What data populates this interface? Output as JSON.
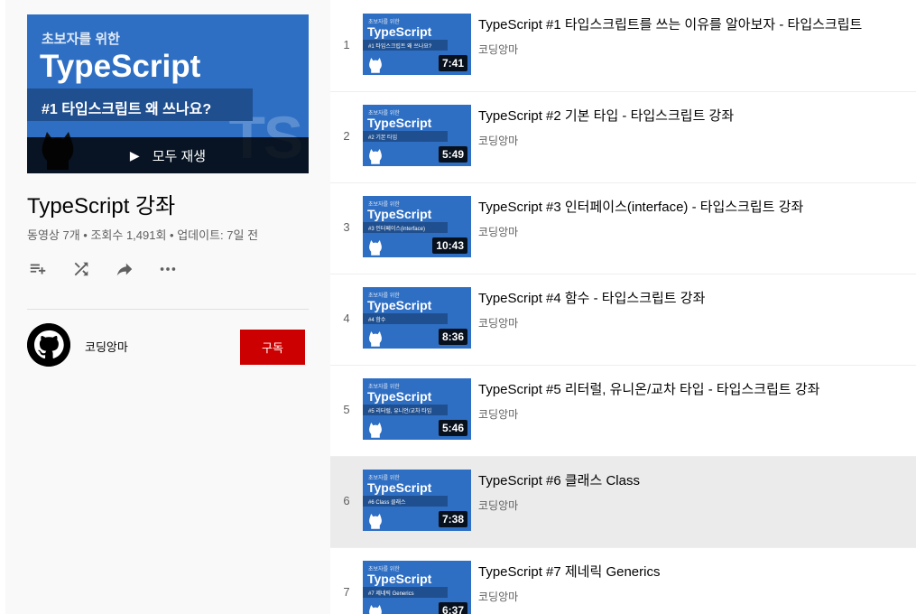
{
  "playlist": {
    "hero": {
      "kicker": "초보자를 위한",
      "title": "TypeScript",
      "subtitle": "#1 타입스크립트 왜 쓰나요?",
      "watermark": "TS",
      "play_all_label": "모두 재생",
      "play_icon": "play-icon"
    },
    "title": "TypeScript 강좌",
    "stats": "동영상 7개 • 조회수 1,491회 • 업데이트: 7일 전",
    "actions": [
      {
        "icon": "add-to-queue-icon"
      },
      {
        "icon": "shuffle-icon"
      },
      {
        "icon": "share-icon"
      },
      {
        "icon": "more-icon"
      }
    ],
    "owner": {
      "name": "코딩앙마",
      "subscribe_label": "구독",
      "avatar_icon": "github-octocat-icon"
    }
  },
  "colors": {
    "accent_red": "#cc0000",
    "thumb_blue": "#2e6fc4",
    "active_row": "#ebebeb"
  },
  "videos": [
    {
      "index": "1",
      "title": "TypeScript #1 타입스크립트를 쓰는 이유를 알아보자 - 타입스크립트",
      "channel": "코딩앙마",
      "duration": "7:41",
      "thumb_kicker": "초보자를 위한",
      "thumb_title": "TypeScript",
      "thumb_sub": "#1 타입스크립트 왜 쓰나요?",
      "active": false
    },
    {
      "index": "2",
      "title": "TypeScript #2 기본 타입 - 타입스크립트 강좌",
      "channel": "코딩앙마",
      "duration": "5:49",
      "thumb_kicker": "초보자를 위한",
      "thumb_title": "TypeScript",
      "thumb_sub": "#2 기본 타입",
      "active": false
    },
    {
      "index": "3",
      "title": "TypeScript #3 인터페이스(interface) - 타입스크립트 강좌",
      "channel": "코딩앙마",
      "duration": "10:43",
      "thumb_kicker": "초보자를 위한",
      "thumb_title": "TypeScript",
      "thumb_sub": "#3 인터페이스(interface)",
      "active": false
    },
    {
      "index": "4",
      "title": "TypeScript #4 함수 - 타입스크립트 강좌",
      "channel": "코딩앙마",
      "duration": "8:36",
      "thumb_kicker": "초보자를 위한",
      "thumb_title": "TypeScript",
      "thumb_sub": "#4 함수",
      "active": false
    },
    {
      "index": "5",
      "title": "TypeScript #5 리터럴, 유니온/교차 타입 - 타입스크립트 강좌",
      "channel": "코딩앙마",
      "duration": "5:46",
      "thumb_kicker": "초보자를 위한",
      "thumb_title": "TypeScript",
      "thumb_sub": "#5 리터럴, 유니언/교차 타입",
      "active": false
    },
    {
      "index": "6",
      "title": "TypeScript #6 클래스 Class",
      "channel": "코딩앙마",
      "duration": "7:38",
      "thumb_kicker": "초보자를 위한",
      "thumb_title": "TypeScript",
      "thumb_sub": "#6 Class 클래스",
      "active": true
    },
    {
      "index": "7",
      "title": "TypeScript #7 제네릭 Generics",
      "channel": "코딩앙마",
      "duration": "6:37",
      "thumb_kicker": "초보자를 위한",
      "thumb_title": "TypeScript",
      "thumb_sub": "#7 제네릭 Generics",
      "active": false
    }
  ]
}
